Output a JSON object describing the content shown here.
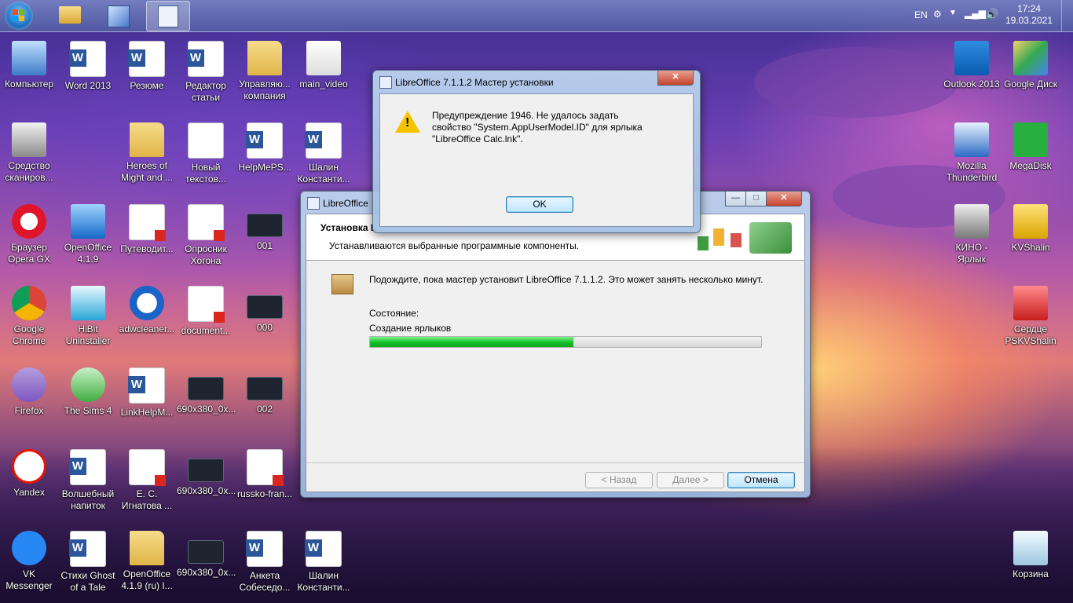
{
  "taskbar": {
    "lang": "EN",
    "time": "17:24",
    "date": "19.03.2021"
  },
  "desktop_icons": [
    {
      "label": "Компьютер",
      "icon": "computer-icon"
    },
    {
      "label": "Word 2013",
      "icon": "word-icon"
    },
    {
      "label": "Резюме",
      "icon": "word-doc-icon"
    },
    {
      "label": "Редактор статьи",
      "icon": "word-doc-icon"
    },
    {
      "label": "Управляю... компания",
      "icon": "folder-icon"
    },
    {
      "label": "main_video",
      "icon": "video-icon"
    },
    {
      "label": "Средство сканиров...",
      "icon": "scanner-icon"
    },
    {
      "label": "Heroes of Might and ...",
      "icon": "folder-icon"
    },
    {
      "label": "Новый текстов...",
      "icon": "text-file-icon"
    },
    {
      "label": "HelpMePS...",
      "icon": "word-doc-icon"
    },
    {
      "label": "Шалин Константи...",
      "icon": "word-doc-icon"
    },
    {
      "label": "Браузер Opera GX",
      "icon": "opera-icon"
    },
    {
      "label": "OpenOffice 4.1.9",
      "icon": "openoffice-icon"
    },
    {
      "label": "Путеводит...",
      "icon": "pdf-icon"
    },
    {
      "label": "Опросник Хогона",
      "icon": "pdf-icon"
    },
    {
      "label": "001",
      "icon": "image-icon"
    },
    {
      "label": "Google Chrome",
      "icon": "chrome-icon"
    },
    {
      "label": "HiBit Uninstaller",
      "icon": "hibit-icon"
    },
    {
      "label": "adwcleaner...",
      "icon": "adwcleaner-icon"
    },
    {
      "label": "document...",
      "icon": "pdf-icon"
    },
    {
      "label": "000",
      "icon": "image-icon"
    },
    {
      "label": "Firefox",
      "icon": "firefox-icon"
    },
    {
      "label": "The Sims 4",
      "icon": "sims-icon"
    },
    {
      "label": "LinkHelpM...",
      "icon": "word-doc-icon"
    },
    {
      "label": "690x380_0x...",
      "icon": "image-icon"
    },
    {
      "label": "002",
      "icon": "image-icon"
    },
    {
      "label": "Yandex",
      "icon": "yandex-icon"
    },
    {
      "label": "Волшебный напиток",
      "icon": "word-doc-icon"
    },
    {
      "label": "Е. С. Игнатова ...",
      "icon": "pdf-icon"
    },
    {
      "label": "690x380_0x...",
      "icon": "image-icon"
    },
    {
      "label": "russko-fran...",
      "icon": "pdf-icon"
    },
    {
      "label": "VK Messenger",
      "icon": "vk-icon"
    },
    {
      "label": "Стихи Ghost of a Tale",
      "icon": "word-doc-icon"
    },
    {
      "label": "OpenOffice 4.1.9 (ru) I...",
      "icon": "folder-icon"
    },
    {
      "label": "690x380_0x...",
      "icon": "image-icon"
    },
    {
      "label": "Анкета Собеседо...",
      "icon": "word-doc-icon"
    },
    {
      "label": "Шалин Константи...",
      "icon": "word-doc-icon"
    },
    {
      "label": "Outlook 2013",
      "icon": "outlook-icon"
    },
    {
      "label": "Google Диск",
      "icon": "google-drive-icon"
    },
    {
      "label": "Mozilla Thunderbird",
      "icon": "thunderbird-icon"
    },
    {
      "label": "MegaDisk",
      "icon": "megadisk-icon"
    },
    {
      "label": "КИНО - Ярлык",
      "icon": "camera-icon"
    },
    {
      "label": "KVShalin",
      "icon": "lock-icon"
    },
    {
      "label": "Сердце PSKVShalin",
      "icon": "heart-icon"
    },
    {
      "label": "Корзина",
      "icon": "recycle-bin-icon"
    }
  ],
  "installer": {
    "title": "LibreOffice",
    "header_title": "Установка L",
    "header_subtitle": "Устанавливаются выбранные программные компоненты.",
    "wait_text": "Подождите, пока мастер установит LibreOffice 7.1.1.2. Это может занять несколько минут.",
    "status_label": "Состояние:",
    "status_value": "Создание ярлыков",
    "progress": 0.52,
    "back_label": "< Назад",
    "next_label": "Далее >",
    "cancel_label": "Отмена"
  },
  "dialog": {
    "title": "LibreOffice 7.1.1.2 Мастер установки",
    "message": "Предупреждение 1946. Не удалось задать свойство \"System.AppUserModel.ID\" для ярлыка \"LibreOffice Calc.lnk\".",
    "ok_label": "OK"
  },
  "colors": {
    "progress_green": "#12c02a",
    "warning_yellow": "#f5c400",
    "close_red": "#c4432c"
  }
}
